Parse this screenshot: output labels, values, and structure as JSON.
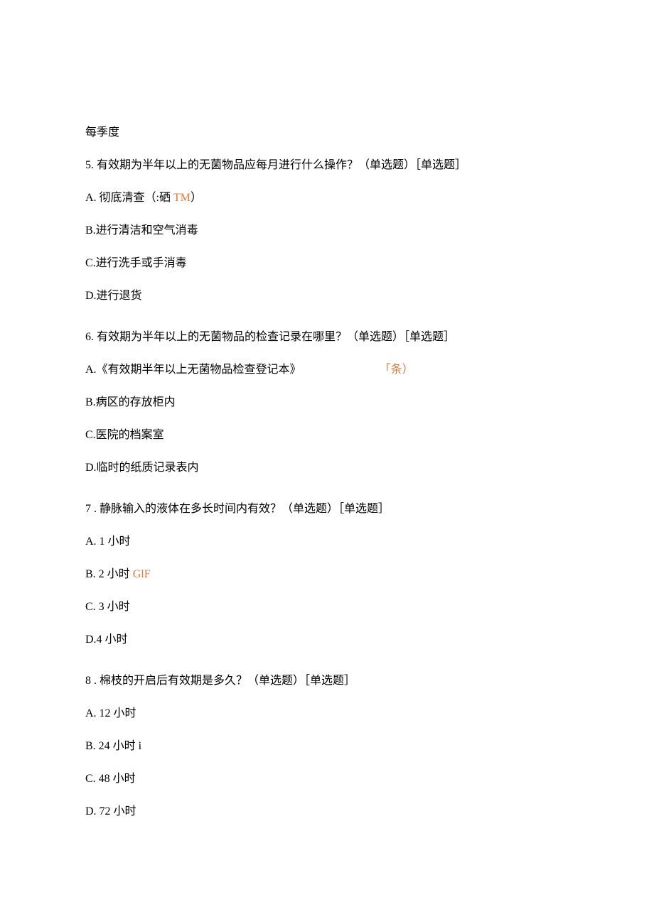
{
  "pre": "每季度",
  "q5": {
    "stem": "5. 有效期为半年以上的无菌物品应每月进行什么操作？（单选题）［单选题］",
    "a_prefix": "A. 彻底清查（:硒 ",
    "a_orange": "TM",
    "a_suffix": "）",
    "b": "B.进行清洁和空气消毒",
    "c": "C.进行洗手或手消毒",
    "d": "D.进行退货"
  },
  "q6": {
    "stem": "6. 有效期为半年以上的无菌物品的检查记录在哪里？（单选题）［单选题］",
    "a_prefix": "A.《有效期半年以上无菌物品检查登记本》",
    "a_orange": "「条）",
    "b": "B.病区的存放柜内",
    "c": "C.医院的档案室",
    "d": "D.临时的纸质记录表内"
  },
  "q7": {
    "stem": "7  . 静脉输入的液体在多长时间内有效？（单选题）［单选题］",
    "a": "A.   1 小时",
    "b_prefix": "B.   2 小时 ",
    "b_orange": "GlF",
    "c": "C.   3 小时",
    "d": "D.4 小时"
  },
  "q8": {
    "stem": "8  . 棉枝的开启后有效期是多久？（单选题）［单选题］",
    "a": "A.   12 小时",
    "b": "B.   24 小时 i",
    "c": "C.   48 小时",
    "d": "D.   72 小时"
  }
}
